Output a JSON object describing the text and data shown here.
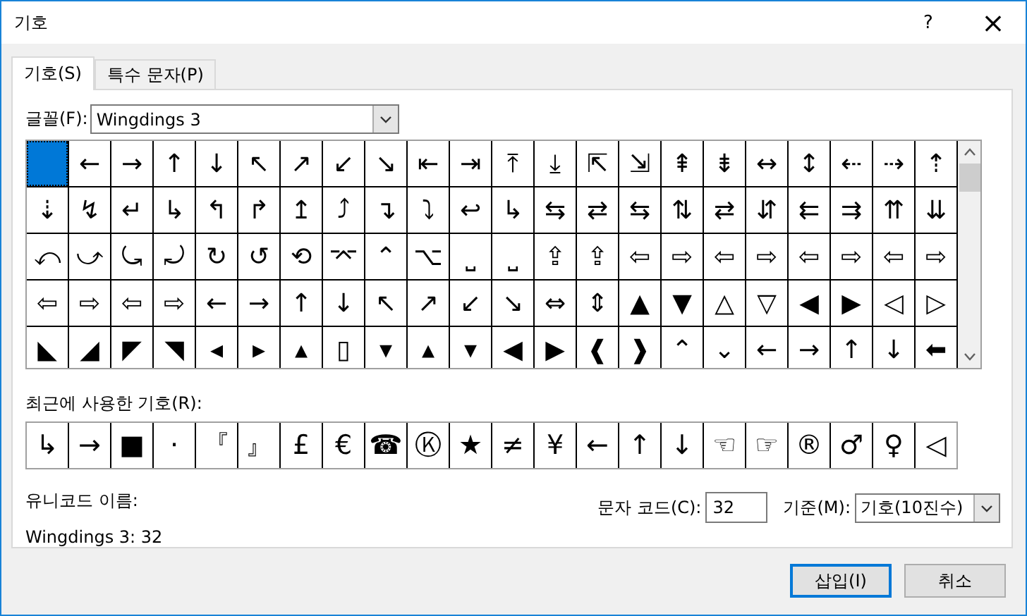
{
  "window": {
    "title": "기호",
    "help": "?",
    "close": "×"
  },
  "tabs": [
    {
      "label": "기호(S)",
      "selected": true
    },
    {
      "label": "특수 문자(P)",
      "selected": false
    }
  ],
  "font": {
    "label": "글꼴(F):",
    "value": "Wingdings 3"
  },
  "symbol_grid": {
    "rows": [
      [
        {
          "selected": true
        },
        {
          "symbol": "←",
          "selected": false
        },
        {
          "symbol": "→",
          "selected": false
        },
        {
          "symbol": "↑",
          "selected": false
        },
        {
          "symbol": "↓",
          "selected": false
        },
        {
          "symbol": "↖",
          "selected": false
        },
        {
          "symbol": "↗",
          "selected": false
        },
        {
          "symbol": "↙",
          "selected": false
        },
        {
          "symbol": "↘",
          "selected": false
        },
        {
          "symbol": "⇤",
          "selected": false
        },
        {
          "symbol": "⇥",
          "selected": false
        },
        {
          "symbol": "⤒",
          "selected": false
        },
        {
          "symbol": "⤓",
          "selected": false
        },
        {
          "symbol": "⇱",
          "selected": false
        },
        {
          "symbol": "⇲",
          "selected": false
        },
        {
          "symbol": "⇞",
          "selected": false
        },
        {
          "symbol": "⇟",
          "selected": false
        },
        {
          "symbol": "↔",
          "selected": false
        },
        {
          "symbol": "↕",
          "selected": false
        },
        {
          "symbol": "⇠",
          "selected": false
        },
        {
          "symbol": "⇢",
          "selected": false
        },
        {
          "symbol": "⇡",
          "selected": false
        }
      ],
      [
        {
          "symbol": "⇣",
          "selected": false
        },
        {
          "symbol": "↯",
          "selected": false
        },
        {
          "symbol": "↵",
          "selected": false
        },
        {
          "symbol": "↳",
          "selected": false
        },
        {
          "symbol": "↰",
          "selected": false
        },
        {
          "symbol": "↱",
          "selected": false
        },
        {
          "symbol": "↥",
          "selected": false
        },
        {
          "symbol": "⤴",
          "selected": false
        },
        {
          "symbol": "↴",
          "selected": false
        },
        {
          "symbol": "⤵",
          "selected": false
        },
        {
          "symbol": "↩",
          "selected": false
        },
        {
          "symbol": "↳",
          "selected": false
        },
        {
          "symbol": "⇆",
          "selected": false
        },
        {
          "symbol": "⇄",
          "selected": false
        },
        {
          "symbol": "⇆",
          "selected": false
        },
        {
          "symbol": "⇅",
          "selected": false
        },
        {
          "symbol": "⇄",
          "selected": false
        },
        {
          "symbol": "⇵",
          "selected": false
        },
        {
          "symbol": "⇇",
          "selected": false
        },
        {
          "symbol": "⇉",
          "selected": false
        },
        {
          "symbol": "⇈",
          "selected": false
        },
        {
          "symbol": "⇊",
          "selected": false
        }
      ],
      [
        {
          "symbol": "⤺",
          "selected": false
        },
        {
          "symbol": "⤻",
          "selected": false
        },
        {
          "symbol": "⤿",
          "selected": false
        },
        {
          "symbol": "⤾",
          "selected": false
        },
        {
          "symbol": "↻",
          "selected": false
        },
        {
          "symbol": "↺",
          "selected": false
        },
        {
          "symbol": "⟲",
          "selected": false
        },
        {
          "symbol": "⌤",
          "selected": false
        },
        {
          "symbol": "⌃",
          "selected": false
        },
        {
          "symbol": "⌥",
          "selected": false
        },
        {
          "symbol": "⎵",
          "selected": false
        },
        {
          "symbol": "⎵",
          "selected": false
        },
        {
          "symbol": "⇪",
          "selected": false
        },
        {
          "symbol": "⇪",
          "selected": false
        },
        {
          "symbol": "⇦",
          "selected": false
        },
        {
          "symbol": "⇨",
          "selected": false
        },
        {
          "symbol": "⇦",
          "selected": false
        },
        {
          "symbol": "⇨",
          "selected": false
        },
        {
          "symbol": "⇦",
          "selected": false
        },
        {
          "symbol": "⇨",
          "selected": false
        },
        {
          "symbol": "⇦",
          "selected": false
        },
        {
          "symbol": "⇨",
          "selected": false
        }
      ],
      [
        {
          "symbol": "⇦",
          "selected": false
        },
        {
          "symbol": "⇨",
          "selected": false
        },
        {
          "symbol": "⇦",
          "selected": false
        },
        {
          "symbol": "⇨",
          "selected": false
        },
        {
          "symbol": "←",
          "selected": false
        },
        {
          "symbol": "→",
          "selected": false
        },
        {
          "symbol": "↑",
          "selected": false
        },
        {
          "symbol": "↓",
          "selected": false
        },
        {
          "symbol": "↖",
          "selected": false
        },
        {
          "symbol": "↗",
          "selected": false
        },
        {
          "symbol": "↙",
          "selected": false
        },
        {
          "symbol": "↘",
          "selected": false
        },
        {
          "symbol": "⇔",
          "selected": false
        },
        {
          "symbol": "⇕",
          "selected": false
        },
        {
          "symbol": "▲",
          "selected": false
        },
        {
          "symbol": "▼",
          "selected": false
        },
        {
          "symbol": "△",
          "selected": false
        },
        {
          "symbol": "▽",
          "selected": false
        },
        {
          "symbol": "◀",
          "selected": false
        },
        {
          "symbol": "▶",
          "selected": false
        },
        {
          "symbol": "◁",
          "selected": false
        },
        {
          "symbol": "▷",
          "selected": false
        }
      ],
      [
        {
          "symbol": "◣",
          "selected": false
        },
        {
          "symbol": "◢",
          "selected": false
        },
        {
          "symbol": "◤",
          "selected": false
        },
        {
          "symbol": "◥",
          "selected": false
        },
        {
          "symbol": "◂",
          "selected": false
        },
        {
          "symbol": "▸",
          "selected": false
        },
        {
          "symbol": "▴",
          "selected": false
        },
        {
          "symbol": "▯",
          "selected": false
        },
        {
          "symbol": "▾",
          "selected": false
        },
        {
          "symbol": "▴",
          "selected": false
        },
        {
          "symbol": "▾",
          "selected": false
        },
        {
          "symbol": "◀",
          "selected": false
        },
        {
          "symbol": "▶",
          "selected": false
        },
        {
          "symbol": "❰",
          "selected": false
        },
        {
          "symbol": "❱",
          "selected": false
        },
        {
          "symbol": "⌃",
          "selected": false
        },
        {
          "symbol": "⌄",
          "selected": false
        },
        {
          "symbol": "←",
          "selected": false
        },
        {
          "symbol": "→",
          "selected": false
        },
        {
          "symbol": "↑",
          "selected": false
        },
        {
          "symbol": "↓",
          "selected": false
        },
        {
          "symbol": "⬅",
          "selected": false
        }
      ]
    ]
  },
  "recent": {
    "label": "최근에 사용한 기호(R):",
    "symbols": [
      "↳",
      "→",
      "■",
      "·",
      "『",
      "』",
      "£",
      "€",
      "☎",
      "Ⓚ",
      "★",
      "≠",
      "¥",
      "←",
      "↑",
      "↓",
      "☜",
      "☞",
      "®",
      "♂",
      "♀",
      "◁"
    ]
  },
  "unicode_name": {
    "label": "유니코드 이름:",
    "value": "Wingdings 3: 32"
  },
  "char_code": {
    "label": "문자 코드(C):",
    "value": "32"
  },
  "basis": {
    "label": "기준(M):",
    "value": "기호(10진수)"
  },
  "buttons": [
    {
      "label": "삽입(I)",
      "default": true
    },
    {
      "label": "취소",
      "default": false
    }
  ]
}
